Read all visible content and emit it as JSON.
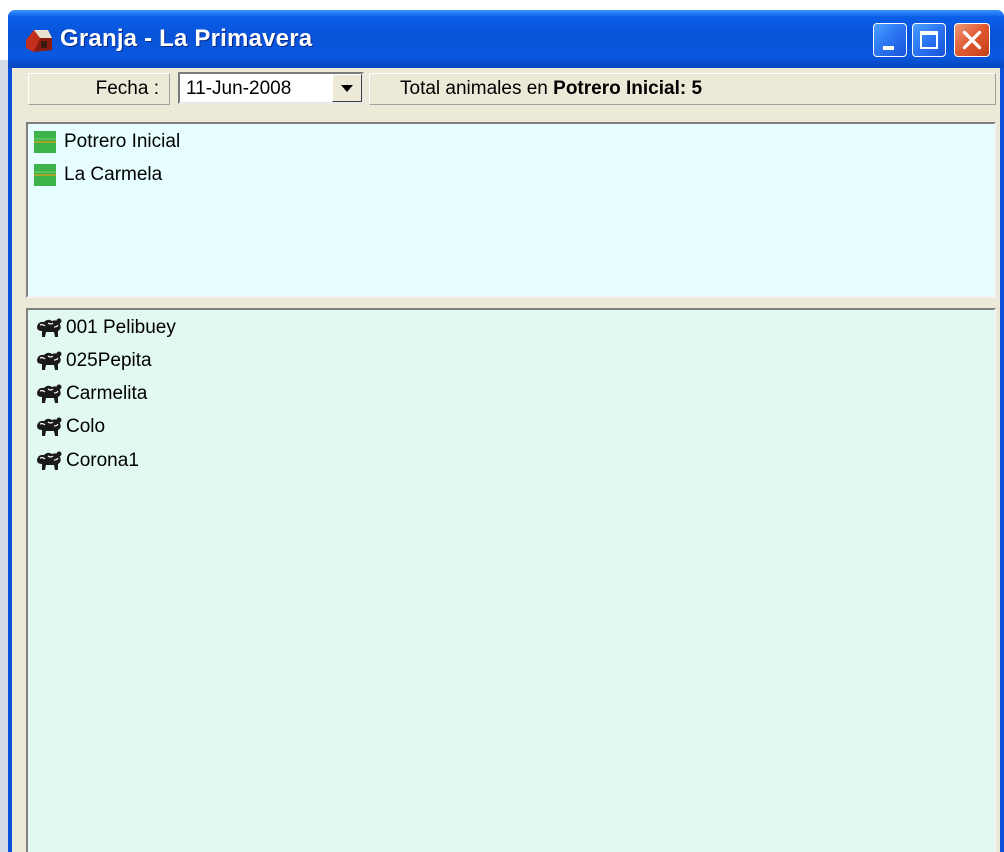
{
  "window": {
    "title": "Granja - La Primavera",
    "app_icon": "farm-house-icon",
    "controls": {
      "minimize": "minimize-icon",
      "maximize": "maximize-icon",
      "close": "close-icon"
    }
  },
  "toolbar": {
    "date_label": "Fecha :",
    "date_value": "11-Jun-2008",
    "total_prefix": "Total animales en",
    "total_strong": "Potrero Inicial: 5"
  },
  "pastures": [
    {
      "label": "Potrero Inicial",
      "icon": "pasture-icon"
    },
    {
      "label": "La Carmela",
      "icon": "pasture-icon"
    }
  ],
  "animals": [
    {
      "label": "001 Pelibuey",
      "icon": "animal-icon"
    },
    {
      "label": "025Pepita",
      "icon": "animal-icon"
    },
    {
      "label": "Carmelita",
      "icon": "animal-icon"
    },
    {
      "label": "Colo",
      "icon": "animal-icon"
    },
    {
      "label": "Corona1",
      "icon": "animal-icon"
    }
  ],
  "colors": {
    "titlebar": "#0a5ee8",
    "pasture_pane_bg": "#e6feff",
    "animal_pane_bg": "#e2f9ef",
    "pasture_icon": "#3cb44a",
    "close_button": "#e0582e"
  }
}
